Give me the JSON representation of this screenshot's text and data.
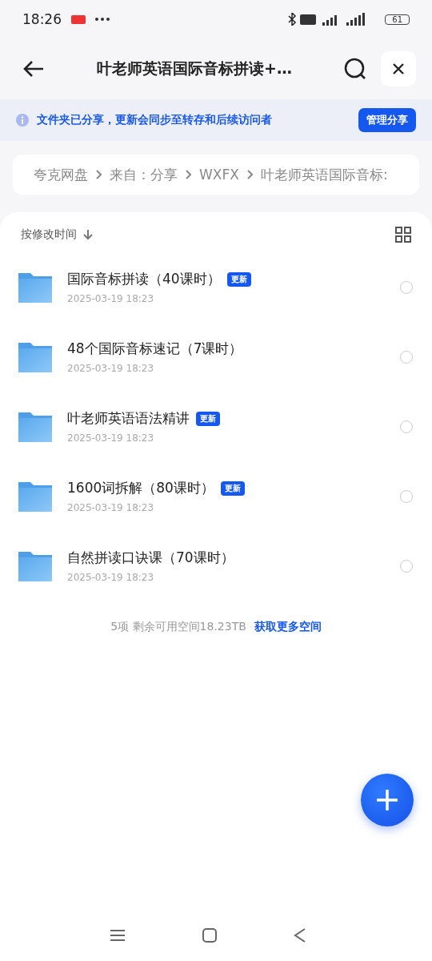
{
  "status_bar": {
    "time": "18:26",
    "battery": "61"
  },
  "header": {
    "title": "叶老师英语国际音标拼读+…"
  },
  "banner": {
    "text": "文件夹已分享，更新会同步至转存和后续访问者",
    "button": "管理分享"
  },
  "breadcrumb": [
    "夸克网盘",
    "来自：分享",
    "WXFX",
    "叶老师英语国际音标:"
  ],
  "sort": {
    "label": "按修改时间"
  },
  "files": [
    {
      "name": "国际音标拼读（40课时）",
      "date": "2025-03-19 18:23",
      "badge": "更新",
      "selected": false
    },
    {
      "name": "48个国际音标速记（7课时）",
      "date": "2025-03-19 18:23",
      "selected": false
    },
    {
      "name": "叶老师英语语法精讲",
      "date": "2025-03-19 18:23",
      "badge": "更新",
      "selected": false
    },
    {
      "name": "1600词拆解（80课时）",
      "date": "2025-03-19 18:23",
      "badge": "更新",
      "selected": false
    },
    {
      "name": "自然拼读口诀课（70课时）",
      "date": "2025-03-19 18:23",
      "selected": false
    }
  ],
  "footer": {
    "summary": "5项 剩余可用空间18.23TB",
    "link": "获取更多空间"
  }
}
